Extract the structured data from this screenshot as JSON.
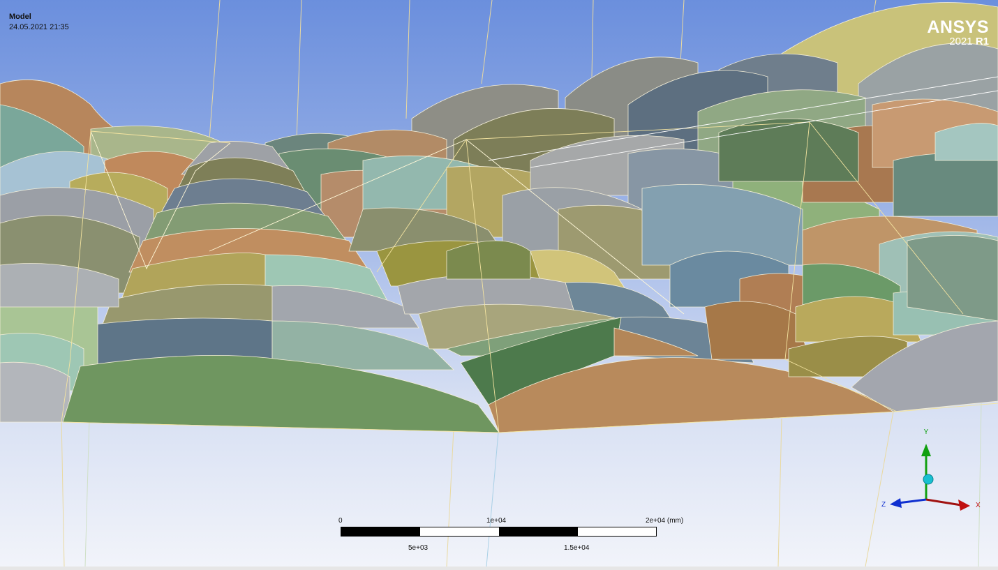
{
  "header": {
    "title": "Model",
    "timestamp": "24.05.2021 21:35"
  },
  "logo": {
    "brand": "ANSYS",
    "year": "2021",
    "release": "R1"
  },
  "scale_bar": {
    "top_labels": [
      "0",
      "1e+04",
      "2e+04 (mm)"
    ],
    "bottom_labels": [
      "5e+03",
      "1.5e+04"
    ]
  },
  "triad": {
    "x_label": "X",
    "y_label": "Y",
    "z_label": "Z"
  },
  "colors": {
    "sky_top": "#6b8fdd",
    "sky_bottom": "#f2f4fa",
    "axis_x": "#c01010",
    "axis_y": "#10a010",
    "axis_z": "#1030d0",
    "origin_ball": "#18c0d0"
  }
}
